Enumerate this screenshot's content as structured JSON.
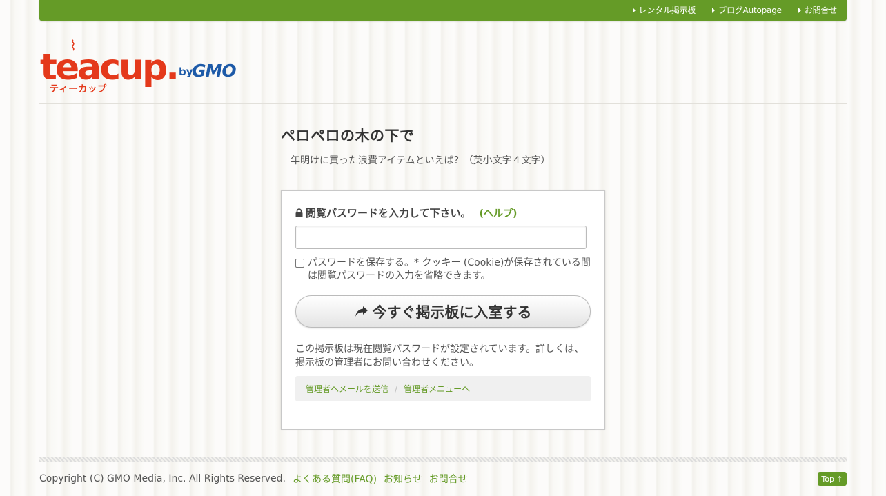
{
  "topnav": {
    "items": [
      {
        "label": "レンタル掲示板"
      },
      {
        "label": "ブログAutopage"
      },
      {
        "label": "お問合せ"
      }
    ]
  },
  "logo": {
    "word": "teacup.",
    "kana": "ティーカップ",
    "by": "by",
    "gmo": "GMO"
  },
  "board": {
    "title": "ペロペロの木の下で",
    "hint": "年明けに買った浪費アイテムといえば？（英小文字４文字）"
  },
  "login": {
    "password_label": "閲覧パスワードを入力して下さい。",
    "help_link": "(ヘルプ)",
    "password_value": "",
    "remember_label": "パスワードを保存する。* クッキー (Cookie)が保存されている間は閲覧パスワードの入力を省略できます。",
    "remember_checked": false,
    "enter_button": "今すぐ掲示板に入室する",
    "notice": "この掲示板は現在閲覧パスワードが設定されています。詳しくは、掲示板の管理者にお問い合わせください。",
    "admin_links": [
      "管理者へメールを送信",
      "管理者メニューへ"
    ],
    "admin_separator": "/"
  },
  "footer": {
    "copyright": "Copyright (C) GMO Media, Inc. All Rights Reserved.",
    "links": [
      "よくある質問(FAQ)",
      "お知らせ",
      "お問合せ"
    ],
    "top_button": "Top ↑"
  },
  "colors": {
    "accent": "#659b27",
    "logo_red": "#e4391b",
    "logo_blue": "#1d5aa8"
  }
}
